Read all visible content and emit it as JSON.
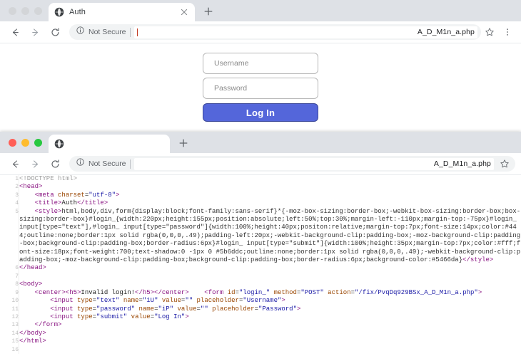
{
  "window_rendered": {
    "name": "browser-window-rendered-page",
    "traffic_lights": {
      "colored": false,
      "labels": [
        "close",
        "minimize",
        "maximize"
      ]
    },
    "tab": {
      "title": "Auth",
      "favicon_icon": "globe-icon",
      "close_icon": "close-icon"
    },
    "new_tab_label": "+",
    "toolbar": {
      "back_icon": "arrow-left-icon",
      "forward_icon": "arrow-right-icon",
      "reload_icon": "reload-icon",
      "info_icon": "info-circle-icon",
      "security_label": "Not Secure",
      "url_visible_suffix": "A_D_M1n_a.php",
      "star_icon": "star-icon",
      "menu_icon": "kebab-menu-icon"
    },
    "page": {
      "username_placeholder": "Username",
      "username_value": "",
      "password_placeholder": "Password",
      "password_value": "",
      "submit_label": "Log In",
      "button_color": "#5466da"
    }
  },
  "window_source": {
    "name": "browser-window-view-source",
    "traffic_lights": {
      "colored": true,
      "labels": [
        "close",
        "minimize",
        "maximize"
      ],
      "red": "#ff5f57",
      "yellow": "#febc2e",
      "green": "#28c840"
    },
    "tab": {
      "title": "",
      "favicon_icon": "globe-icon"
    },
    "new_tab_label": "+",
    "toolbar": {
      "back_icon": "arrow-left-icon",
      "forward_icon": "arrow-right-icon",
      "reload_icon": "reload-icon",
      "info_icon": "info-circle-icon",
      "security_label": "Not Secure",
      "url_visible_suffix": "A_D_M1n_a.php",
      "star_icon": "star-icon"
    },
    "source_lines": [
      {
        "n": "1",
        "html": "<span class=\"cm\">&lt;!DOCTYPE html&gt;</span>"
      },
      {
        "n": "2",
        "html": "<span class=\"tg\">&lt;head&gt;</span>"
      },
      {
        "n": "3",
        "html": "    <span class=\"tg\">&lt;meta</span> <span class=\"at\">charset</span>=<span class=\"av\">\"utf-8\"</span><span class=\"tg\">&gt;</span>"
      },
      {
        "n": "4",
        "html": "    <span class=\"tg\">&lt;title&gt;</span><span class=\"tx\">Auth</span><span class=\"tg\">&lt;/title&gt;</span>"
      },
      {
        "n": "5",
        "html": "    <span class=\"tg\">&lt;style&gt;</span><span class=\"pl\">html,body,div,form{display:block;font-family:sans-serif}*{-moz-box-sizing:border-box;-webkit-box-sizing:border-box;box-sizing:border-box}#login_{width:220px;height:155px;position:absolute;left:50%;top:30%;margin-left:-110px;margin-top:-75px}#login_ input[type=\"text\"],#login_ input[type=\"password\"]{width:100%;height:40px;positon:relative;margin-top:7px;font-size:14px;color:#444;outline:none;border:1px solid rgba(0,0,0,.49);padding-left:20px;-webkit-background-clip:padding-box;-moz-background-clip:padding-box;background-clip:padding-box;border-radius:6px}#login_ input[type=\"submit\"]{width:100%;height:35px;margin-top:7px;color:#fff;font-size:18px;font-weight:700;text-shadow:0 -1px 0 #5b6ddc;outline:none;border:1px solid rgba(0,0,0,.49);-webkit-background-clip:padding-box;-moz-background-clip:padding-box;background-clip:padding-box;border-radius:6px;background-color:#5466da}</span><span class=\"tg\">&lt;/style&gt;</span>"
      },
      {
        "n": "6",
        "html": "<span class=\"tg\">&lt;/head&gt;</span>"
      },
      {
        "n": "7",
        "html": ""
      },
      {
        "n": "8",
        "html": "<span class=\"tg\">&lt;body&gt;</span>"
      },
      {
        "n": "9",
        "html": "    <span class=\"tg\">&lt;center&gt;&lt;h5&gt;</span><span class=\"tx\">Invalid login!</span><span class=\"tg\">&lt;/h5&gt;&lt;/center&gt;</span>    <span class=\"tg\">&lt;form</span> <span class=\"at\">id</span>=<span class=\"av\">\"login_\"</span> <span class=\"at\">method</span>=<span class=\"av\">\"POST\"</span> <span class=\"at\">action</span>=<span class=\"av\">\"/fix/PvqDq929BSx_A_D_M1n_a.php\"</span><span class=\"tg\">&gt;</span>"
      },
      {
        "n": "10",
        "html": "        <span class=\"tg\">&lt;input</span> <span class=\"at\">type</span>=<span class=\"av\">\"text\"</span> <span class=\"at\">name</span>=<span class=\"av\">\"iU\"</span> <span class=\"at\">value</span>=<span class=\"av\">\"\"</span> <span class=\"at\">placeholder</span>=<span class=\"av\">\"Username\"</span><span class=\"tg\">&gt;</span>"
      },
      {
        "n": "11",
        "html": "        <span class=\"tg\">&lt;input</span> <span class=\"at\">type</span>=<span class=\"av\">\"password\"</span> <span class=\"at\">name</span>=<span class=\"av\">\"iP\"</span> <span class=\"at\">value</span>=<span class=\"av\">\"\"</span> <span class=\"at\">placeholder</span>=<span class=\"av\">\"Password\"</span><span class=\"tg\">&gt;</span>"
      },
      {
        "n": "12",
        "html": "        <span class=\"tg\">&lt;input</span> <span class=\"at\">type</span>=<span class=\"av\">\"submit\"</span> <span class=\"at\">value</span>=<span class=\"av\">\"Log In\"</span><span class=\"tg\">&gt;</span>"
      },
      {
        "n": "13",
        "html": "    <span class=\"tg\">&lt;/form&gt;</span>"
      },
      {
        "n": "14",
        "html": "<span class=\"tg\">&lt;/body&gt;</span>"
      },
      {
        "n": "15",
        "html": "<span class=\"tg\">&lt;/html&gt;</span>"
      },
      {
        "n": "16",
        "html": ""
      }
    ]
  }
}
